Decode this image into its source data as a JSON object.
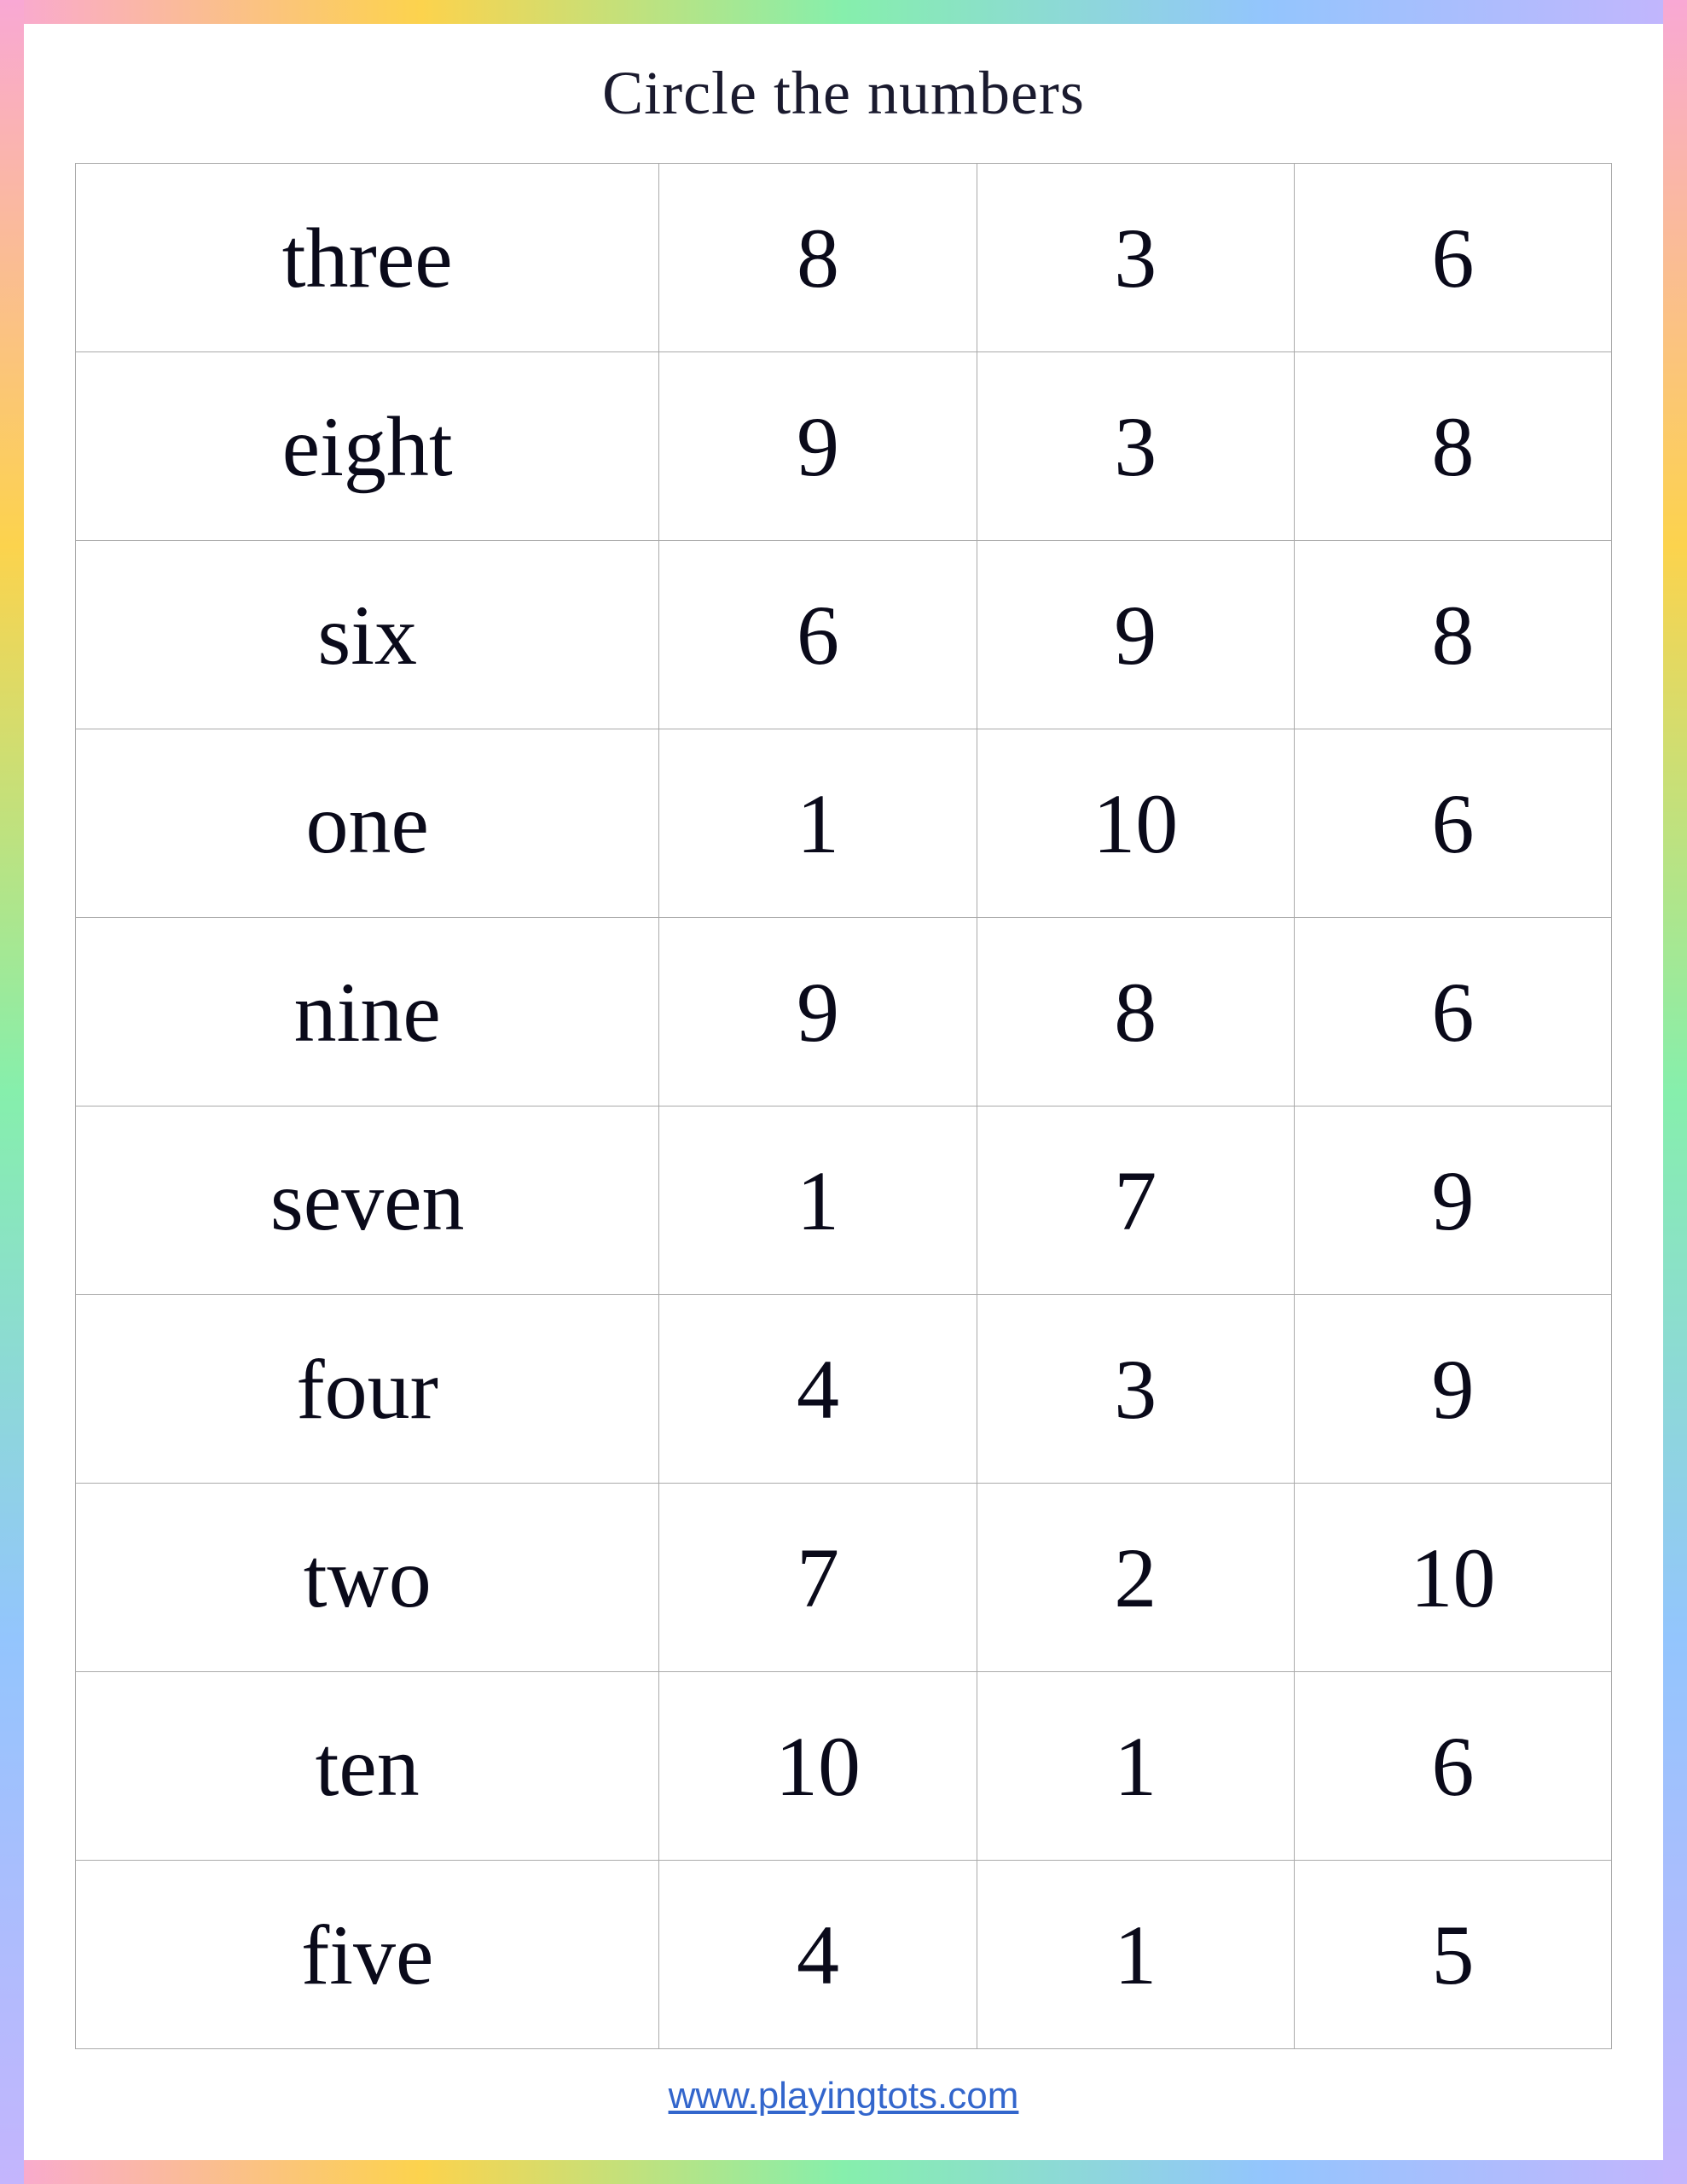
{
  "page": {
    "title": "Circle the numbers",
    "footer_link": "www.playingtots.com"
  },
  "rows": [
    {
      "word": "three",
      "n1": "8",
      "n2": "3",
      "n3": "6"
    },
    {
      "word": "eight",
      "n1": "9",
      "n2": "3",
      "n3": "8"
    },
    {
      "word": "six",
      "n1": "6",
      "n2": "9",
      "n3": "8"
    },
    {
      "word": "one",
      "n1": "1",
      "n2": "10",
      "n3": "6"
    },
    {
      "word": "nine",
      "n1": "9",
      "n2": "8",
      "n3": "6"
    },
    {
      "word": "seven",
      "n1": "1",
      "n2": "7",
      "n3": "9"
    },
    {
      "word": "four",
      "n1": "4",
      "n2": "3",
      "n3": "9"
    },
    {
      "word": "two",
      "n1": "7",
      "n2": "2",
      "n3": "10"
    },
    {
      "word": "ten",
      "n1": "10",
      "n2": "1",
      "n3": "6"
    },
    {
      "word": "five",
      "n1": "4",
      "n2": "1",
      "n3": "5"
    }
  ]
}
